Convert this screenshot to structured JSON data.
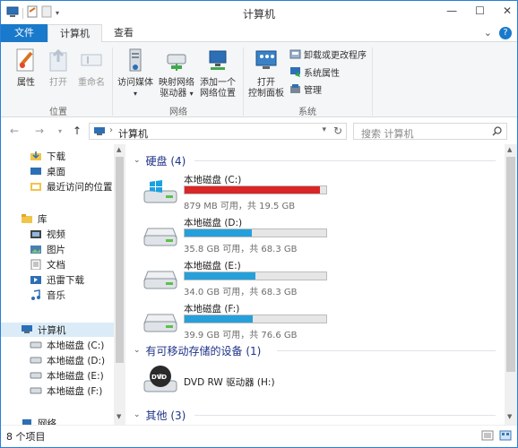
{
  "window": {
    "title": "计算机"
  },
  "tabs": [
    {
      "label": "文件"
    },
    {
      "label": "计算机"
    },
    {
      "label": "查看"
    }
  ],
  "ribbon": {
    "properties": "属性",
    "open": "打开",
    "rename": "重命名",
    "location_group": "位置",
    "media_line1": "访问媒体",
    "map_line1": "映射网络",
    "map_line2": "驱动器",
    "add_line1": "添加一个",
    "add_line2": "网络位置",
    "network_group": "网络",
    "cp_line1": "打开",
    "cp_line2": "控制面板",
    "uninstall": "卸载或更改程序",
    "sysprops": "系统属性",
    "manage": "管理",
    "system_group": "系统"
  },
  "address": {
    "path": "计算机"
  },
  "search": {
    "placeholder": "搜索 计算机"
  },
  "nav": {
    "downloads": "下载",
    "desktop": "桌面",
    "recent": "最近访问的位置",
    "libraries": "库",
    "videos": "视频",
    "pictures": "图片",
    "documents": "文档",
    "xunlei": "迅雷下载",
    "music": "音乐",
    "computer": "计算机",
    "drive_c": "本地磁盘 (C:)",
    "drive_d": "本地磁盘 (D:)",
    "drive_e": "本地磁盘 (E:)",
    "drive_f": "本地磁盘 (F:)",
    "network": "网络"
  },
  "groups": {
    "hdd": "硬盘 (4)",
    "removable": "有可移动存储的设备 (1)",
    "other": "其他 (3)"
  },
  "drives": [
    {
      "name": "本地磁盘 (C:)",
      "size": "879 MB 可用，共 19.5 GB",
      "used": 0.956,
      "critical": true
    },
    {
      "name": "本地磁盘 (D:)",
      "size": "35.8 GB 可用，共 68.3 GB",
      "used": 0.476,
      "critical": false
    },
    {
      "name": "本地磁盘 (E:)",
      "size": "34.0 GB 可用，共 68.3 GB",
      "used": 0.502,
      "critical": false
    },
    {
      "name": "本地磁盘 (F:)",
      "size": "39.9 GB 可用，共 76.6 GB",
      "used": 0.479,
      "critical": false
    }
  ],
  "dvd": {
    "name": "DVD RW 驱动器 (H:)",
    "badge": "DVD"
  },
  "status": {
    "count": "8 个项目"
  },
  "colors": {
    "accent": "#1979ca",
    "bar_normal": "#26a0da",
    "bar_critical": "#da2626"
  }
}
